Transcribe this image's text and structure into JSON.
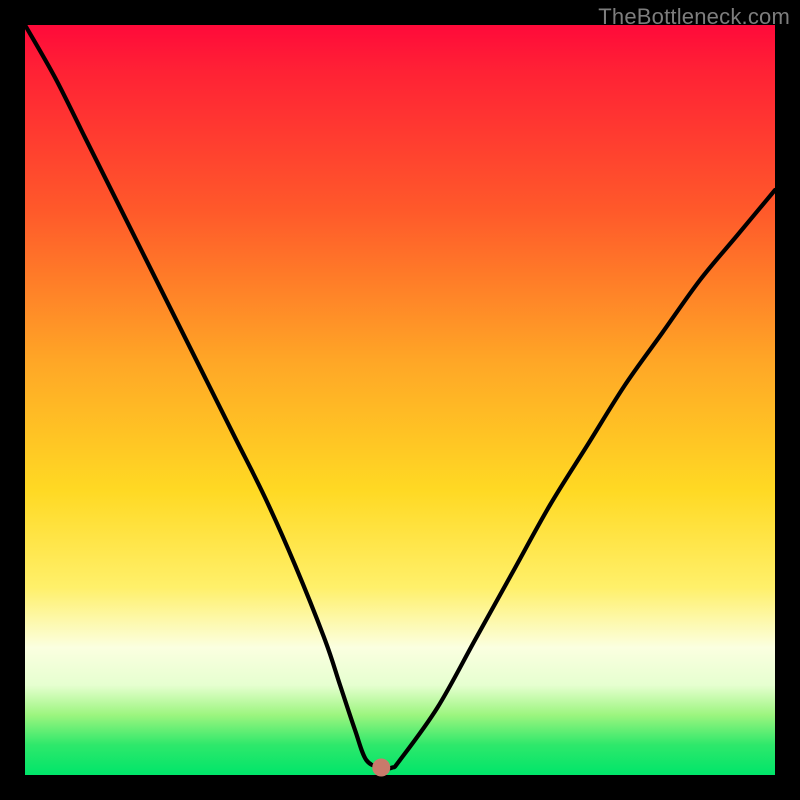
{
  "watermark": "TheBottleneck.com",
  "marker": {
    "color": "#c97a6b",
    "radius": 9
  },
  "chart_data": {
    "type": "line",
    "title": "",
    "xlabel": "",
    "ylabel": "",
    "xlim": [
      0,
      100
    ],
    "ylim": [
      0,
      100
    ],
    "grid": false,
    "legend": false,
    "series": [
      {
        "name": "bottleneck-curve",
        "x": [
          0,
          4,
          8,
          12,
          16,
          20,
          24,
          28,
          32,
          36,
          40,
          42,
          44,
          45.5,
          47.5,
          49,
          50,
          55,
          60,
          65,
          70,
          75,
          80,
          85,
          90,
          95,
          100
        ],
        "y": [
          100,
          93,
          85,
          77,
          69,
          61,
          53,
          45,
          37,
          28,
          18,
          12,
          6,
          2,
          1,
          1,
          2,
          9,
          18,
          27,
          36,
          44,
          52,
          59,
          66,
          72,
          78
        ]
      }
    ],
    "marker_point": {
      "x": 47.5,
      "y": 1
    },
    "flat_segment": {
      "x_start": 45.5,
      "x_end": 49,
      "y": 1
    }
  }
}
